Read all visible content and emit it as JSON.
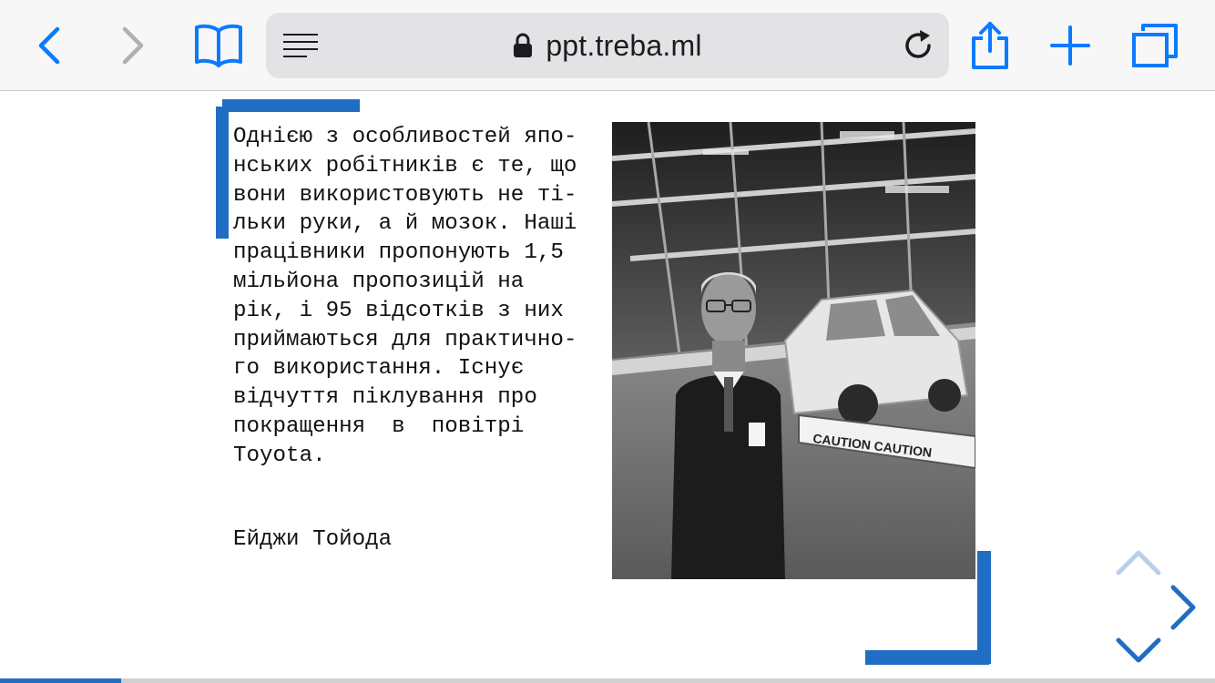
{
  "toolbar": {
    "url": "ppt.treba.ml"
  },
  "slide": {
    "quote_lines": [
      "Однією з особливостей япо-",
      "нських робітників є те, що",
      "вони використовують не ті-",
      "льки руки, а й мозок. Наші",
      "працівники пропонують 1,5",
      "мільйона пропозицій на",
      "рік, і 95 відсотків з них",
      "приймаються для практично-",
      "го використання. Існує",
      "відчуття піклування про",
      "покращення  в  повітрі",
      "Toyota."
    ],
    "author": "Ейджи Тойода",
    "photo_caption_sign": "CAUTION CAUTION"
  },
  "progress": {
    "fraction": 0.1
  },
  "colors": {
    "accent": "#1f6ec4",
    "ios_blue": "#0a7aff",
    "nav_disabled": "#b9cfea"
  },
  "icons": {
    "back": "chevron-left-icon",
    "forward": "chevron-right-icon",
    "bookmarks": "book-icon",
    "reader": "reader-lines-icon",
    "lock": "lock-icon",
    "reload": "reload-icon",
    "share": "share-icon",
    "new_tab": "plus-icon",
    "tabs": "tabs-icon"
  }
}
